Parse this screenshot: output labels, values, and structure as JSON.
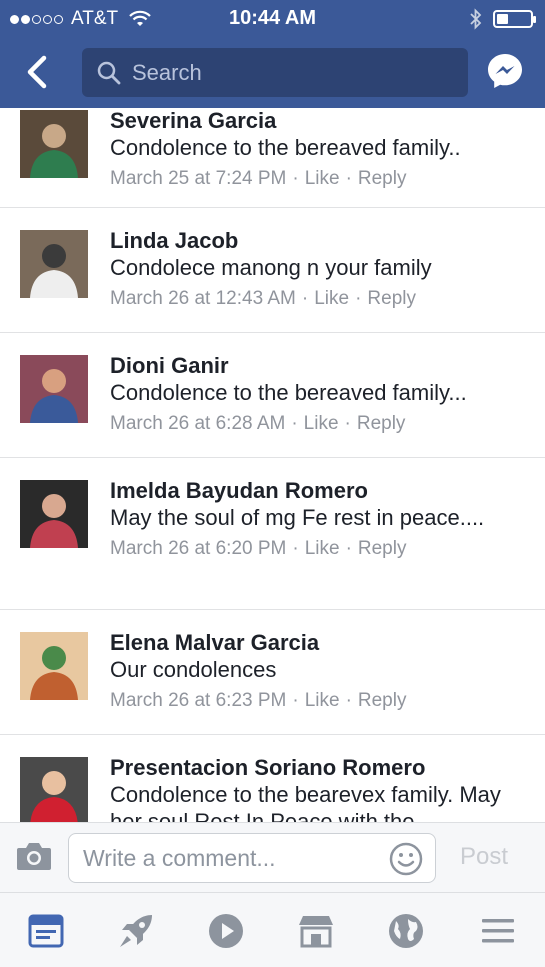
{
  "status_bar": {
    "carrier": "AT&T",
    "time": "10:44 AM",
    "signal_bars_filled": 2,
    "signal_bars_total": 5,
    "battery_level": 0.35
  },
  "navbar": {
    "back_icon": "chevron-left-icon",
    "search_placeholder": "Search",
    "messenger_icon": "messenger-icon"
  },
  "comments": [
    {
      "name": "Severina Garcia",
      "text": "Condolence to the bereaved family..",
      "date": "March 25 at 7:24 PM",
      "like": "Like",
      "reply": "Reply",
      "avatar_colors": [
        "#5a4a3a",
        "#2e7d4f",
        "#c8a888"
      ]
    },
    {
      "name": "Linda Jacob",
      "text": "Condolece manong  n your family",
      "date": "March 26 at 12:43 AM",
      "like": "Like",
      "reply": "Reply",
      "avatar_colors": [
        "#7a6a5a",
        "#eeeeee",
        "#3b3b3b"
      ]
    },
    {
      "name": "Dioni Ganir",
      "text": "Condolence to the bereaved family...",
      "date": "March 26 at 6:28 AM",
      "like": "Like",
      "reply": "Reply",
      "avatar_colors": [
        "#8a4a5a",
        "#3a5a9a",
        "#d8a080"
      ]
    },
    {
      "name": "Imelda Bayudan Romero",
      "text": "May the soul of mg Fe rest in peace....",
      "date": "March 26 at 6:20 PM",
      "like": "Like",
      "reply": "Reply",
      "avatar_colors": [
        "#2a2a2a",
        "#c04050",
        "#d8a890"
      ]
    },
    {
      "name": "Elena Malvar Garcia",
      "text": "Our condolences",
      "date": "March 26 at 6:23 PM",
      "like": "Like",
      "reply": "Reply",
      "avatar_colors": [
        "#e8c8a0",
        "#c06030",
        "#4a8a4a"
      ]
    },
    {
      "name": "Presentacion Soriano Romero",
      "text": "Condolence to the bearevex family. May her soul Rest In Peace with the",
      "date": "",
      "like": "",
      "reply": "",
      "avatar_colors": [
        "#4a4a4a",
        "#d02030",
        "#e8c0a0"
      ]
    }
  ],
  "composer": {
    "camera_icon": "camera-icon",
    "placeholder": "Write a comment...",
    "emoji_icon": "smiley-icon",
    "post_label": "Post"
  },
  "tabbar": {
    "tabs": [
      {
        "icon": "news-feed-icon",
        "active": true
      },
      {
        "icon": "rocket-icon",
        "active": false
      },
      {
        "icon": "video-play-icon",
        "active": false
      },
      {
        "icon": "marketplace-icon",
        "active": false
      },
      {
        "icon": "globe-icon",
        "active": false
      },
      {
        "icon": "menu-icon",
        "active": false
      }
    ]
  },
  "colors": {
    "brand": "#3b5998",
    "active_tab": "#4267b2",
    "inactive_tab": "#8d949e",
    "meta_text": "#90949c"
  }
}
